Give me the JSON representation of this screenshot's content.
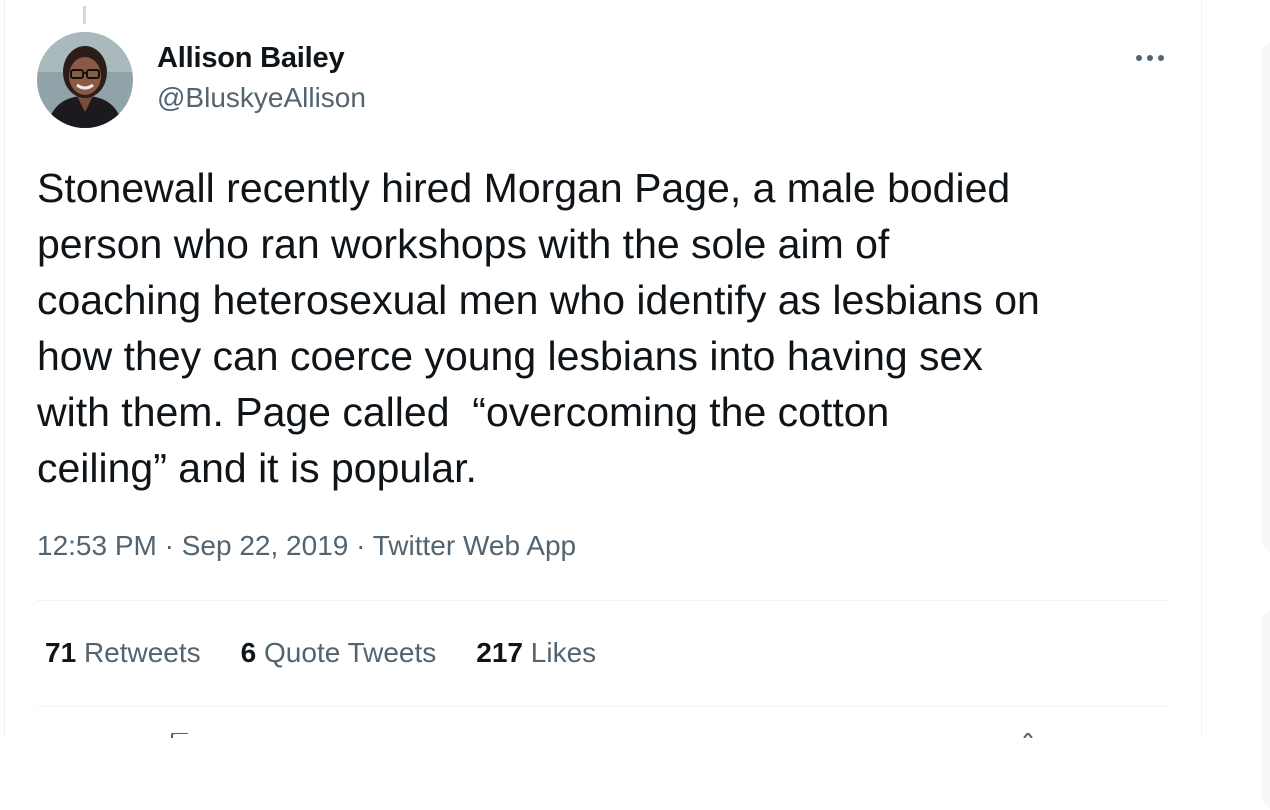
{
  "author": {
    "name": "Allison Bailey",
    "handle": "@BluskyeAllison"
  },
  "tweet": {
    "lines": [
      "Stonewall recently hired Morgan Page, a male bodied",
      "person who ran workshops with the sole aim of",
      "coaching heterosexual men who identify as lesbians on",
      "how they can coerce young lesbians into having sex",
      "with them. Page called  “overcoming the cotton",
      "ceiling” and it is popular."
    ]
  },
  "meta": {
    "time": "12:53 PM",
    "sep1": " · ",
    "date": "Sep 22, 2019",
    "sep2": " · ",
    "app": "Twitter Web App"
  },
  "stats": {
    "retweets": {
      "count": "71",
      "label": "Retweets"
    },
    "quotes": {
      "count": "6",
      "label": "Quote Tweets"
    },
    "likes": {
      "count": "217",
      "label": "Likes"
    }
  },
  "icons": {
    "more": "more-horizontal-icon"
  },
  "colors": {
    "text_primary": "#0f1419",
    "text_secondary": "#536471",
    "border": "#eff3f4"
  }
}
